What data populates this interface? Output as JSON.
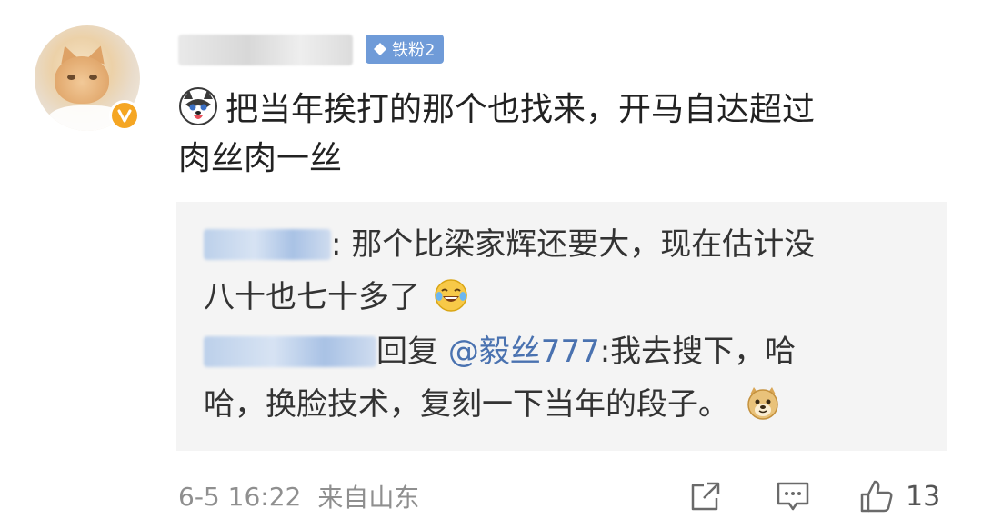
{
  "post": {
    "fan_badge": "铁粉2",
    "text_line1": "把当年挨打的那个也找来，开马自达超过",
    "text_line2": "肉丝肉一丝"
  },
  "replies": [
    {
      "sep": ": ",
      "text_line1": "那个比梁家辉还要大，现在估计没",
      "text_line2": "八十也七十多了"
    },
    {
      "reply_word": "回复",
      "mention": "@毅丝777",
      "text_line1": ":我去搜下，哈",
      "text_line2": "哈，换脸技术，复刻一下当年的段子。"
    }
  ],
  "footer": {
    "time": "6-5 16:22",
    "source": "来自山东",
    "like_count": "13"
  },
  "icons": {
    "vip_badge": "verified-v-icon",
    "share": "share-icon",
    "comment": "comment-icon",
    "like": "thumbs-up-icon"
  },
  "colors": {
    "fan_badge_bg": "#6f9bd8",
    "link": "#4a72b0",
    "verified": "#f5a623"
  }
}
